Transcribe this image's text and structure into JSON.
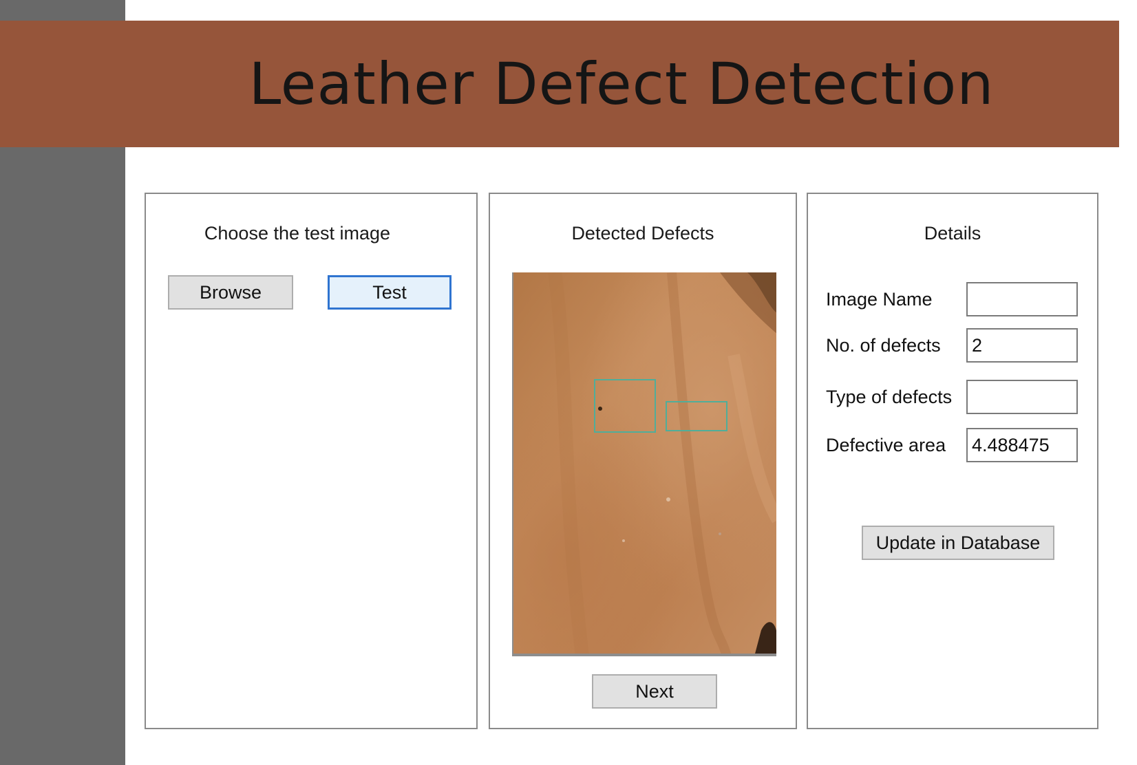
{
  "app": {
    "title": "Leather Defect Detection"
  },
  "colors": {
    "banner": "#96553a",
    "sidebar_strip": "#696969",
    "leather_base": "#c48a5a",
    "defect_box": "#4fae9a",
    "focus_border": "#2f74d0"
  },
  "panels": {
    "choose": {
      "title": "Choose the test image",
      "browse_label": "Browse",
      "test_label": "Test"
    },
    "detected": {
      "title": "Detected Defects",
      "image_name": "leather-sample-image",
      "defect_boxes_count": 2,
      "next_label": "Next"
    },
    "details": {
      "title": "Details",
      "fields": [
        {
          "label": "Image Name",
          "value": ""
        },
        {
          "label": "No. of defects",
          "value": "2"
        },
        {
          "label": "Type of defects",
          "value": ""
        },
        {
          "label": "Defective area",
          "value": "4.488475"
        }
      ],
      "update_label": "Update in Database"
    }
  }
}
